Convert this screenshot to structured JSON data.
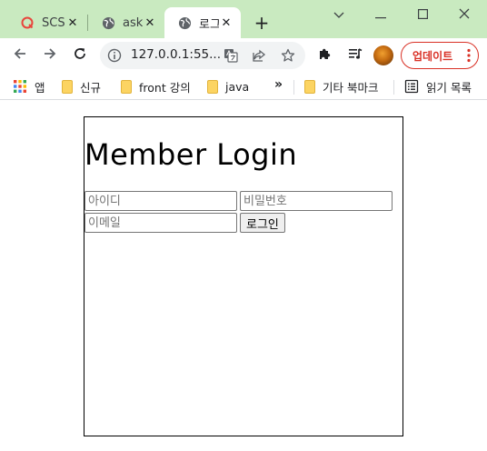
{
  "tabs": [
    {
      "title": "SCS",
      "icon": "qualys-icon"
    },
    {
      "title": "ask_",
      "icon": "globe-icon"
    },
    {
      "title": "로그",
      "icon": "globe-icon",
      "active": true
    }
  ],
  "toolbar": {
    "url": "127.0.0.1:55...",
    "update_label": "업데이트"
  },
  "bookmarks": {
    "apps": "앱",
    "items": [
      "신규",
      "front 강의",
      "java"
    ],
    "other": "기타 북마크",
    "reading_list": "읽기 목록"
  },
  "page": {
    "title": "Member Login",
    "id_placeholder": "아이디",
    "password_placeholder": "비밀번호",
    "email_placeholder": "이메일",
    "login_button": "로그인"
  },
  "colors": {
    "tabstrip_bg": "#c9eac0",
    "update_accent": "#d93025",
    "folder": "#fcd462"
  }
}
